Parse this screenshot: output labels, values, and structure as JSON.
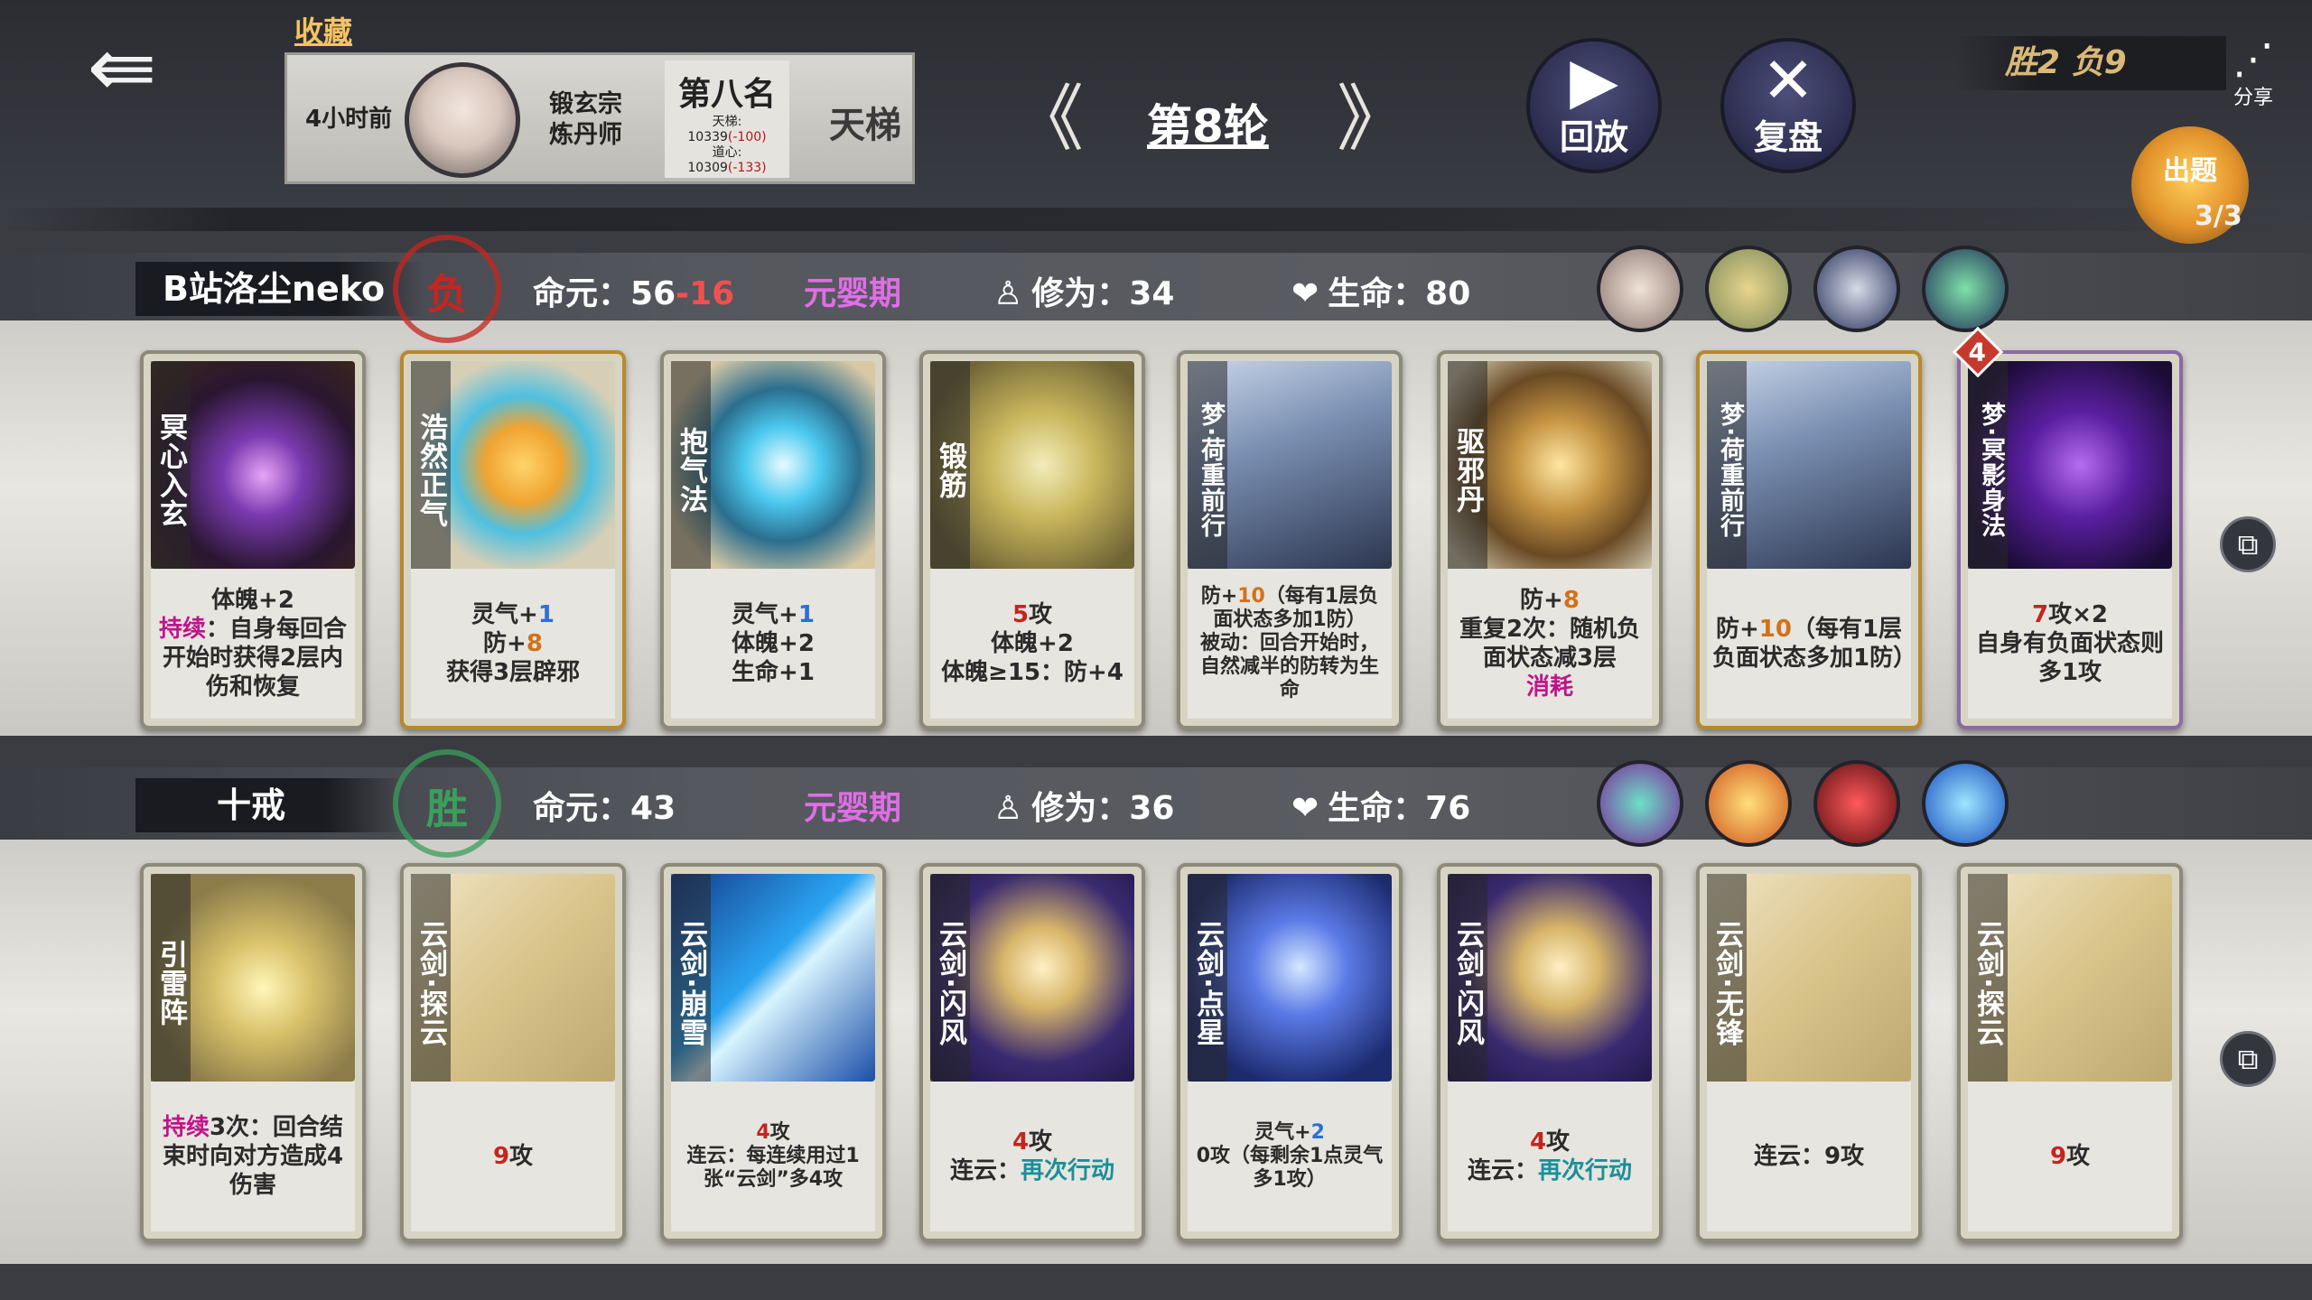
{
  "header": {
    "collect_label": "收藏",
    "opponent": {
      "time": "4小时前",
      "sect": "锻玄宗",
      "role": "炼丹师",
      "rank": "第八名",
      "ladder_line": "天梯:",
      "ladder_value": "10339",
      "ladder_delta": "(-100)",
      "daoxin_line": "道心:",
      "daoxin_value": "10309",
      "daoxin_delta": "(-133)",
      "ladder_label": "天梯"
    },
    "round_title": "第8轮",
    "replay_label": "回放",
    "review_label": "复盘",
    "record": "胜2 负9",
    "share_label": "分享",
    "quiz_label": "出题",
    "quiz_count": "3/3"
  },
  "player1": {
    "name": "B站洛尘neko",
    "result": "负",
    "life_label": "命元：",
    "life_base": "56",
    "life_delta": "-16",
    "realm": "元婴期",
    "cultivation": "修为：34",
    "hp": "生命：80",
    "cards": [
      {
        "name": "冥心入玄",
        "lines": [
          "体魄+2"
        ],
        "keyword": "持续",
        "after": "：自身每回合开始时获得2层内伤和恢复"
      },
      {
        "name": "浩然正气",
        "l1a": "灵气+",
        "l1b": "1",
        "l2a": "防+",
        "l2b": "8",
        "l3": "获得3层辟邪"
      },
      {
        "name": "抱气法",
        "l1a": "灵气+",
        "l1b": "1",
        "l2": "体魄+2",
        "l3": "生命+1"
      },
      {
        "name": "锻筋",
        "l1a": "5",
        "l1b": "攻",
        "l2": "体魄+2",
        "l3": "体魄≥15：防+4"
      },
      {
        "name": "梦·荷重前行",
        "l1a": "防+",
        "l1b": "10",
        "l1c": "（每有1层负面状态多加1防）",
        "l2": "被动：回合开始时，自然减半的防转为生命"
      },
      {
        "name": "驱邪丹",
        "l1a": "防+",
        "l1b": "8",
        "l2": "重复2次：随机负面状态减3层",
        "l3": "消耗"
      },
      {
        "name": "梦·荷重前行",
        "l1a": "防+",
        "l1b": "10",
        "l1c": "（每有1层负面状态多加1防）"
      },
      {
        "name": "梦·冥影身法",
        "l1a": "7",
        "l1b": "攻×2",
        "l2": "自身有负面状态则多1攻",
        "badge": "4"
      }
    ]
  },
  "player2": {
    "name": "十戒",
    "result": "胜",
    "life_label": "命元：",
    "life_base": "43",
    "realm": "元婴期",
    "cultivation": "修为：36",
    "hp": "生命：76",
    "cards": [
      {
        "name": "引雷阵",
        "keyword": "持续",
        "after": "3次：回合结束时向对方造成4伤害"
      },
      {
        "name": "云剑·探云",
        "l1a": "9",
        "l1b": "攻"
      },
      {
        "name": "云剑·崩雪",
        "l1a": "4",
        "l1b": "攻",
        "l2": "连云：每连续用过1张“云剑”多4攻"
      },
      {
        "name": "云剑·闪风",
        "l1a": "4",
        "l1b": "攻",
        "l2a": "连云：",
        "l2b": "再次行动"
      },
      {
        "name": "云剑·点星",
        "l1a": "灵气+",
        "l1b": "2",
        "l2": "0攻（每剩余1点灵气多1攻）"
      },
      {
        "name": "云剑·闪风",
        "l1a": "4",
        "l1b": "攻",
        "l2a": "连云：",
        "l2b": "再次行动"
      },
      {
        "name": "云剑·无锋",
        "l2": "连云：9攻"
      },
      {
        "name": "云剑·探云",
        "l1a": "9",
        "l1b": "攻"
      }
    ]
  },
  "colors": {
    "realm": "#e06ee6",
    "lose": "#c5261f",
    "win": "#3a9f5b",
    "record": "#d9b878"
  },
  "icons": {
    "back": "back-arrow-icon",
    "replay": "play-icon",
    "review": "crossed-swords-icon",
    "share": "share-icon",
    "cultivation": "meditation-icon",
    "hp": "heart-icon",
    "copy": "copy-icon"
  }
}
